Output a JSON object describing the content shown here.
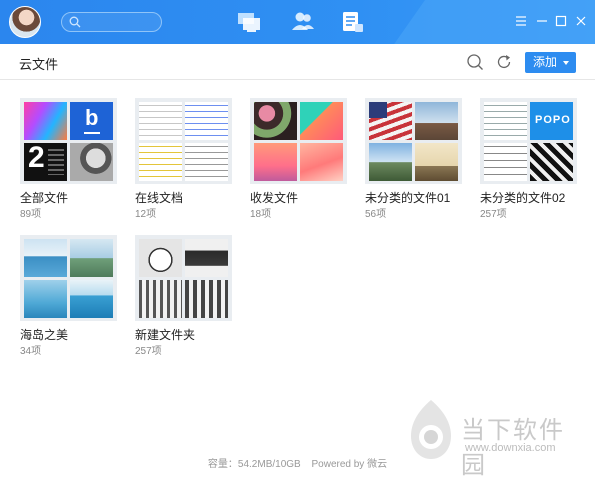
{
  "topbar": {
    "search_placeholder": "",
    "nav_icons": [
      "desktop-icon",
      "contacts-icon",
      "notes-icon"
    ],
    "window_controls": [
      "menu-icon",
      "minimize-icon",
      "maximize-icon",
      "close-icon"
    ],
    "accent": "#2d8cf0"
  },
  "header": {
    "title": "云文件",
    "add_label": "添加"
  },
  "folders": [
    {
      "name": "全部文件",
      "count": "89项"
    },
    {
      "name": "在线文档",
      "count": "12项"
    },
    {
      "name": "收发文件",
      "count": "18项"
    },
    {
      "name": "未分类的文件01",
      "count": "56项"
    },
    {
      "name": "未分类的文件02",
      "count": "257项"
    },
    {
      "name": "海岛之美",
      "count": "34项"
    },
    {
      "name": "新建文件夹",
      "count": "257项"
    }
  ],
  "thumb_texts": {
    "b_logo": "b",
    "two": "2",
    "popo": "POPO"
  },
  "footer": {
    "storage": "容量：54.2MB/10GB",
    "powered": "Powered by 微云"
  },
  "watermark": {
    "brand": "当下软件园",
    "url": "www.downxia.com"
  }
}
